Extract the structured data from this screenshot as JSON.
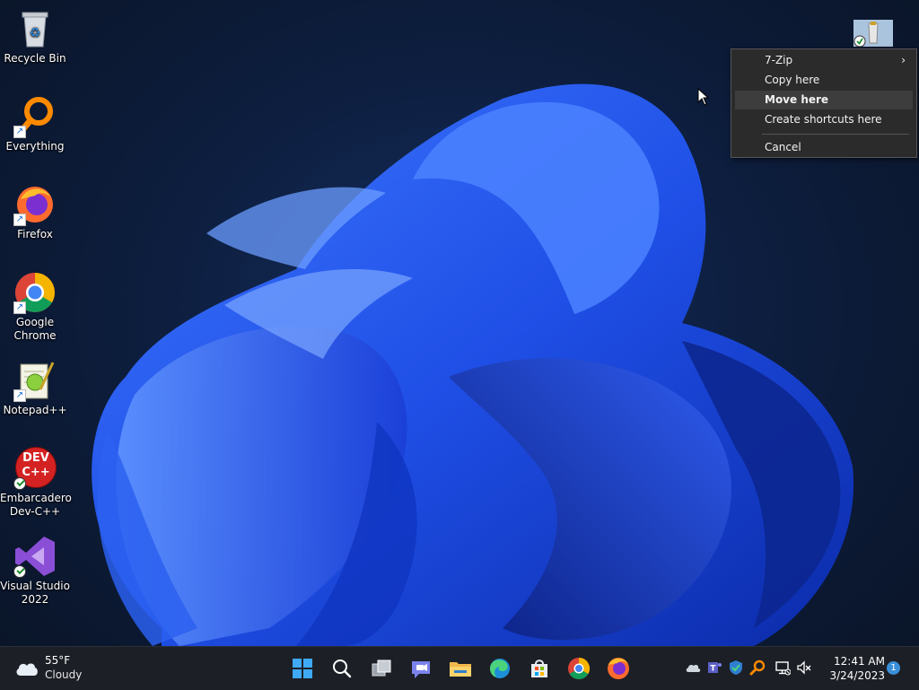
{
  "desktop": {
    "icons": [
      {
        "label": "Recycle Bin"
      },
      {
        "label": "Everything"
      },
      {
        "label": "Firefox"
      },
      {
        "label": "Google\nChrome"
      },
      {
        "label": "Notepad++"
      },
      {
        "label": "Embarcadero\nDev-C++"
      },
      {
        "label": "Visual Studio\n2022"
      }
    ],
    "devcpp_glyph_text": "DEV\nC++"
  },
  "context_menu": {
    "items": [
      {
        "label": "7-Zip",
        "submenu_glyph": "›"
      },
      {
        "label": "Copy here"
      },
      {
        "label": "Move here"
      },
      {
        "label": "Create shortcuts here"
      },
      {
        "label": "Cancel"
      }
    ]
  },
  "taskbar": {
    "weather": {
      "temp": "55°F",
      "condition": "Cloudy"
    },
    "clock": {
      "time": "12:41 AM",
      "date": "3/24/2023"
    },
    "notification_count": "1"
  },
  "colors": {
    "menu_bg": "#2b2b2b",
    "menu_hover": "#3d3d3d",
    "taskbar_bg": "#1c1f26",
    "accent": "#3a8fd9"
  }
}
